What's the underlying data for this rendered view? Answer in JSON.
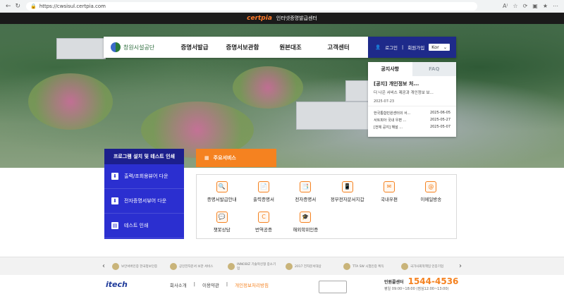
{
  "browser": {
    "url": "https://cwsisul.certpia.com",
    "nav_back": "←",
    "nav_reload": "↻",
    "icons_right": [
      "A⁾",
      "☆",
      "⟳",
      "▣",
      "★",
      "⋯"
    ]
  },
  "brandbar": {
    "logo": "certpia",
    "title": "인터넷증명발급센터"
  },
  "mainnav": {
    "org_name": "창원시설공단",
    "menu": [
      "증명서발급",
      "증명서보관함",
      "원본대조",
      "고객센터"
    ],
    "login": "로그인",
    "signup": "회원가입",
    "lang": "Kor",
    "lang_arrow": "⌄"
  },
  "notice": {
    "tab_active": "공지사항",
    "tab_inactive": "FAQ",
    "headline": "[공지] 개인정보 처...",
    "sub": "더 나은 서비스 제공과 개인정보 보...",
    "date": "2025-07-23",
    "items": [
      {
        "title": "한국통합민원센터의 서...",
        "date": "2025-06-05"
      },
      {
        "title": "서트피아 국내 우편 ...",
        "date": "2025-05-27"
      },
      {
        "title": "[전체 공지] 해설 ...",
        "date": "2025-05-07"
      }
    ]
  },
  "program": {
    "header": "프로그램 설치 및 테스트 인쇄",
    "items": [
      "출력/조회용뷰어 다운",
      "전자증명서뷰어 다운",
      "테스트 인쇄"
    ]
  },
  "services": {
    "tab_label": "주요서비스",
    "row1": [
      "증명서발급안내",
      "출력증명서",
      "전자증명서",
      "정부전자문서지갑",
      "국내우편",
      "이메일방송"
    ],
    "row2": [
      "챗봇상담",
      "번역공증",
      "해외학위인증"
    ],
    "icons1": [
      "🔍",
      "📄",
      "📑",
      "📱",
      "✉",
      "@"
    ],
    "icons2": [
      "💬",
      "C",
      "🎓"
    ]
  },
  "partners": {
    "items": [
      "보안서버인증 한국정보인증",
      "공인전자문서 보관 서비스",
      "INNOBIZ 기술혁신형 중소기업",
      "2017 전자문서대상",
      "TTA SW 시험인증 획득",
      "국가사회적책임 인증기업"
    ],
    "prev": "‹",
    "next": "›"
  },
  "footer": {
    "logo": "itech",
    "links": [
      "회사소개",
      "이용약관",
      "개인정보처리방침"
    ],
    "call_label": "민원콜센터",
    "phone": "1544-4536",
    "hours": "평일 09:00~18:00 (점심12:00~13:00)"
  }
}
